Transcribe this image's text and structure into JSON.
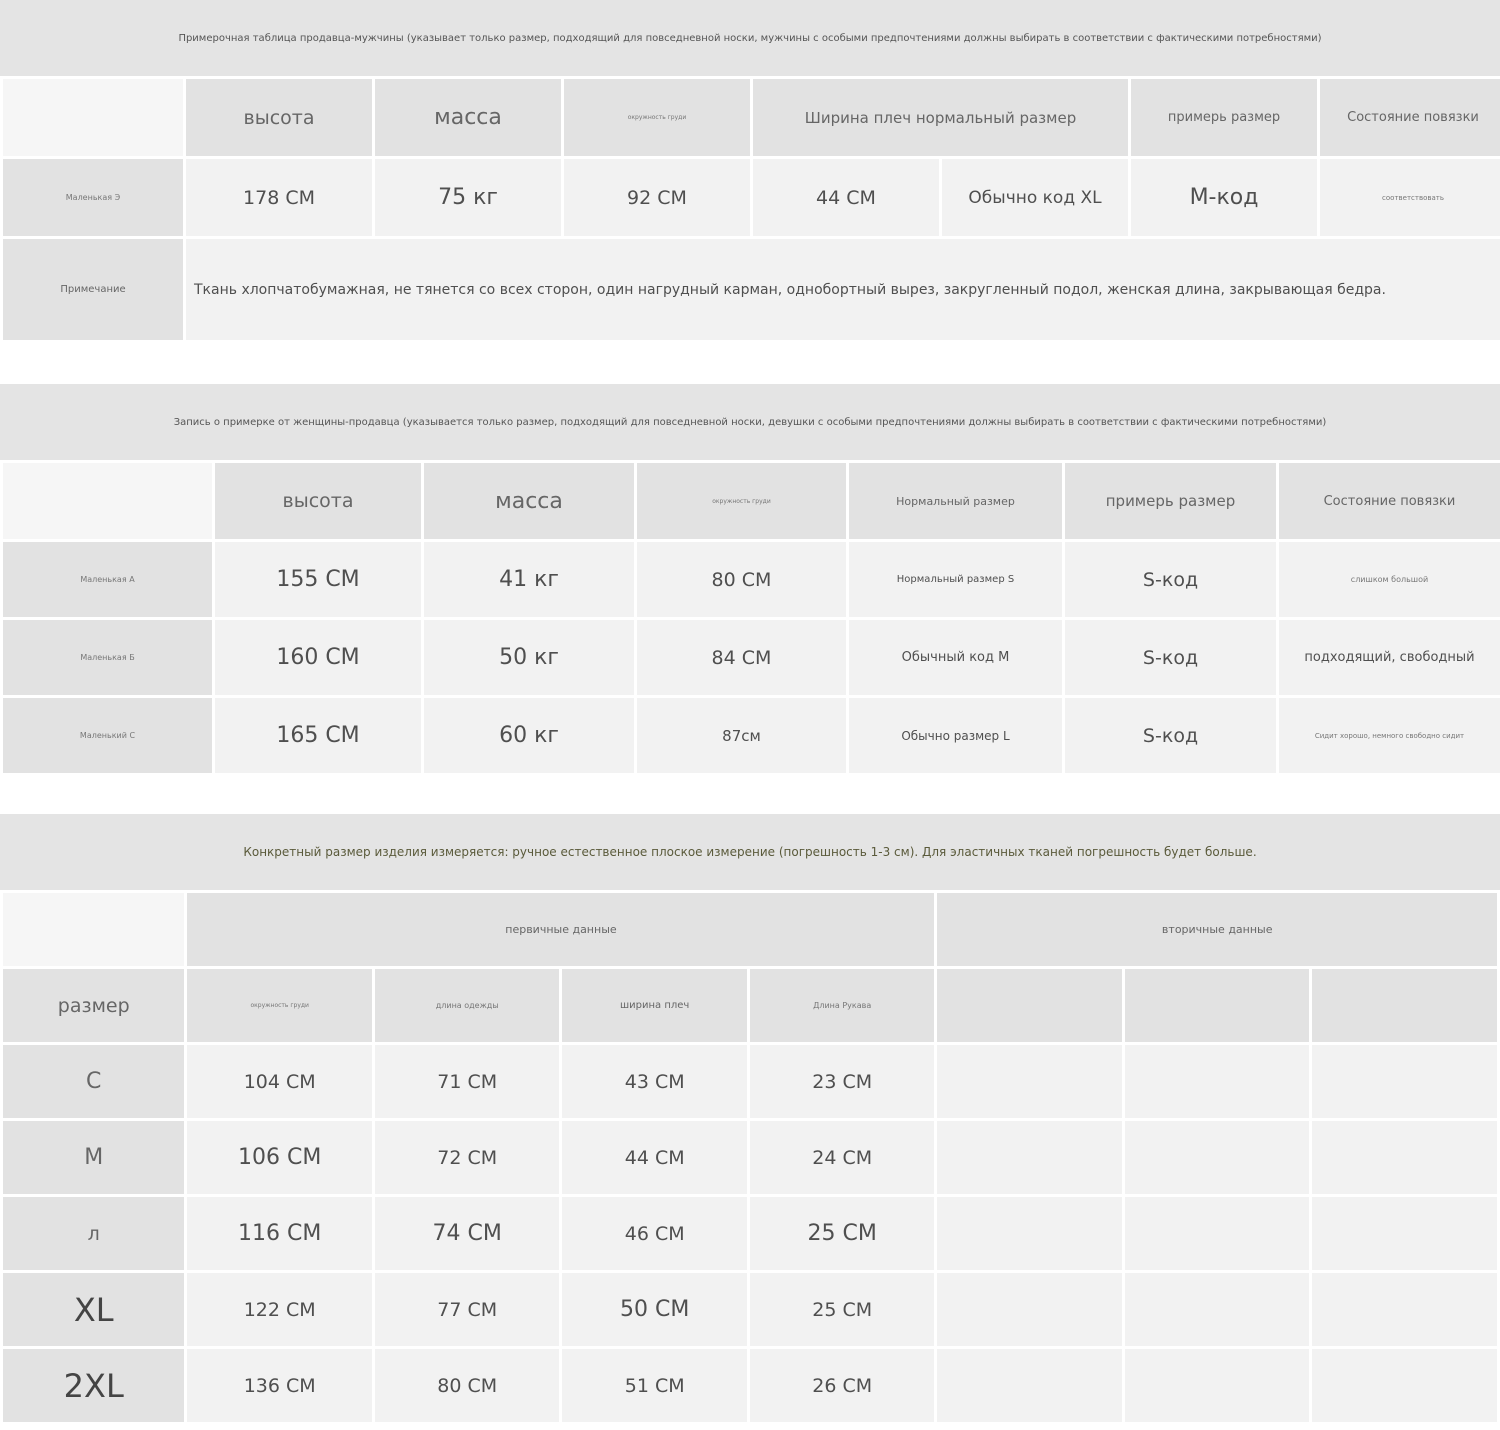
{
  "men": {
    "caption": "Примерочная таблица продавца-мужчины (указывает только размер, подходящий для повседневной носки, мужчины с особыми предпочтениями должны выбирать в соответствии с фактическими потребностями)",
    "headers": [
      "высота",
      "масса",
      "окружность груди",
      "Ширина плеч нормальный размер",
      "примерь размер",
      "Состояние повязки"
    ],
    "row_label": "Маленькая Э",
    "row": [
      "178 CM",
      "75 кг",
      "92 CM",
      "44 CM",
      "Обычно код XL",
      "M-код",
      "соответствовать"
    ],
    "note_label": "Примечание",
    "note_text": "Ткань хлопчатобумажная, не тянется со всех сторон, один нагрудный карман, однобортный вырез, закругленный подол, женская длина, закрывающая бедра."
  },
  "women": {
    "caption": "Запись о примерке от женщины-продавца (указывается только размер, подходящий для повседневной носки, девушки с особыми предпочтениями должны выбирать в соответствии с фактическими потребностями)",
    "headers": [
      "высота",
      "масса",
      "окружность груди",
      "Нормальный размер",
      "примерь размер",
      "Состояние повязки"
    ],
    "rows": [
      {
        "label": "Маленькая А",
        "cells": [
          "155 CM",
          "41 кг",
          "80 CM",
          "Нормальный размер S",
          "S-код",
          "слишком большой"
        ]
      },
      {
        "label": "Маленькая Б",
        "cells": [
          "160 CM",
          "50 кг",
          "84 CM",
          "Обычный код M",
          "S-код",
          "подходящий, свободный"
        ]
      },
      {
        "label": "Маленький С",
        "cells": [
          "165 CM",
          "60 кг",
          "87см",
          "Обычно размер L",
          "S-код",
          "Сидит хорошо, немного свободно сидит"
        ]
      }
    ]
  },
  "product": {
    "caption": "Конкретный размер изделия измеряется: ручное естественное плоское измерение (погрешность 1-3 см). Для эластичных тканей погрешность будет больше.",
    "primary_label": "первичные данные",
    "secondary_label": "вторичные данные",
    "size_label": "размер",
    "headers": [
      "окружность груди",
      "длина одежды",
      "ширина плеч",
      "Длина Рукава"
    ],
    "rows": [
      {
        "size": "С",
        "cells": [
          "104 CM",
          "71 CM",
          "43 CM",
          "23 CM"
        ]
      },
      {
        "size": "M",
        "cells": [
          "106 CM",
          "72 CM",
          "44 CM",
          "24 CM"
        ]
      },
      {
        "size": "л",
        "cells": [
          "116 CM",
          "74 CM",
          "46 CM",
          "25 CM"
        ]
      },
      {
        "size": "XL",
        "cells": [
          "122 CM",
          "77 CM",
          "50 CM",
          "25 CM"
        ]
      },
      {
        "size": "2XL",
        "cells": [
          "136 CM",
          "80 CM",
          "51 CM",
          "26 CM"
        ]
      }
    ]
  }
}
